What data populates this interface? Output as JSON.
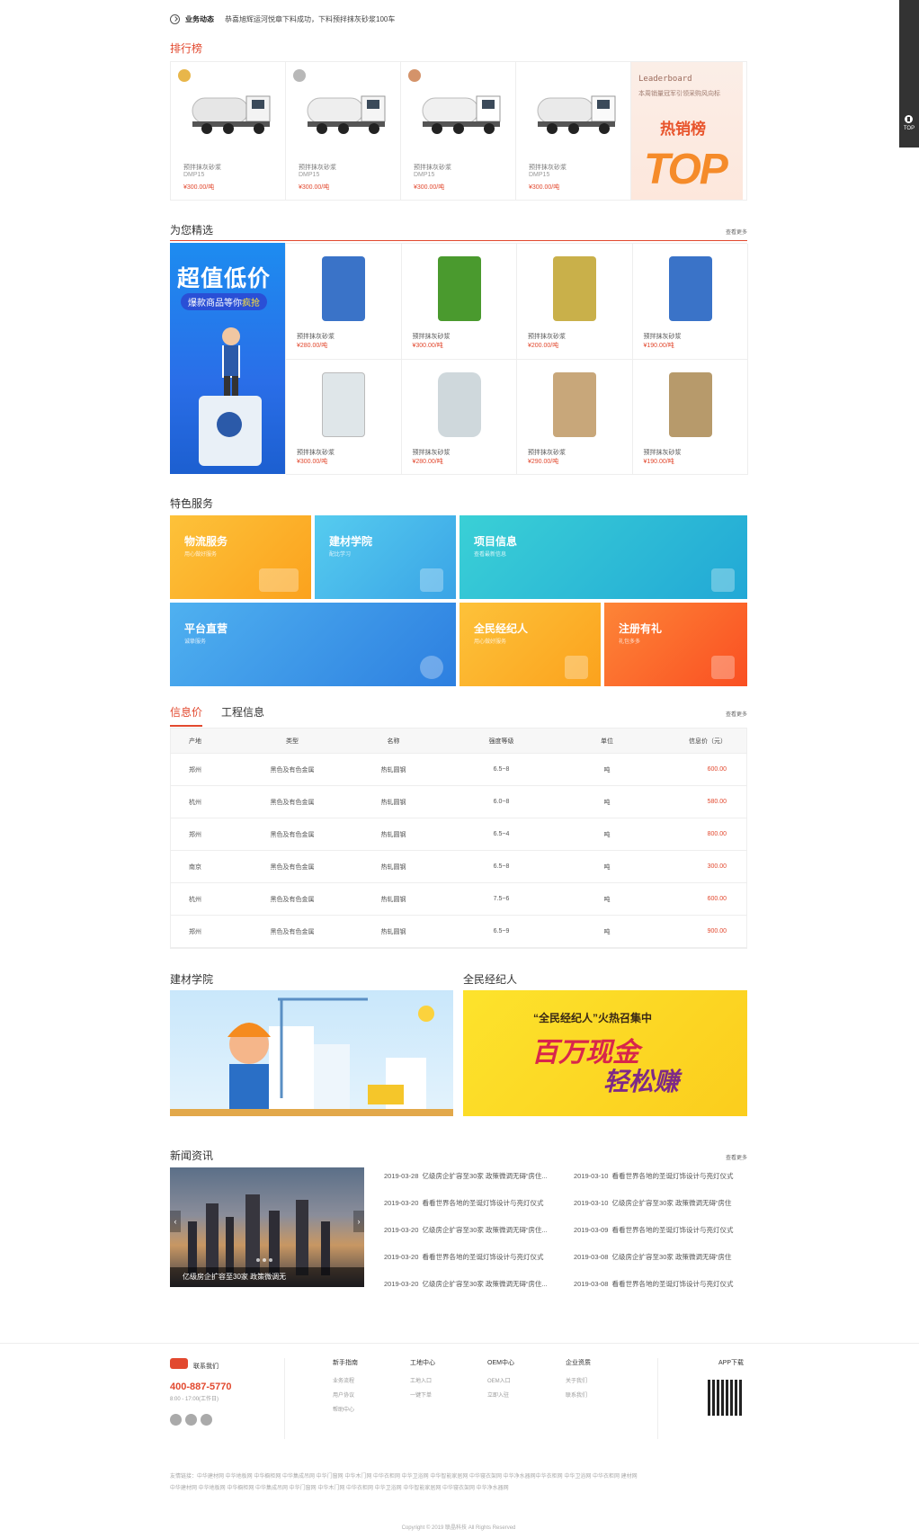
{
  "side": {
    "top_label": "TOP"
  },
  "notice": {
    "label": "业务动态",
    "text": "恭喜旭辉运河悦章下料成功，下料预拌抹灰砂浆100车"
  },
  "ranking": {
    "title": "排行榜",
    "items": [
      {
        "name": "预拌抹灰砂浆",
        "code": "DMP15",
        "price": "¥300.00/吨",
        "medal_color": "#e8b64a"
      },
      {
        "name": "预拌抹灰砂浆",
        "code": "DMP15",
        "price": "¥300.00/吨",
        "medal_color": "#b8b8b8"
      },
      {
        "name": "预拌抹灰砂浆",
        "code": "DMP15",
        "price": "¥300.00/吨",
        "medal_color": "#d4936a"
      },
      {
        "name": "预拌抹灰砂浆",
        "code": "DMP15",
        "price": "¥300.00/吨",
        "medal_color": ""
      }
    ],
    "banner": {
      "line1": "Leaderboard",
      "line2": "本周销量冠军引领采购风向标",
      "hot": "热销榜",
      "top": "TOP"
    }
  },
  "picks": {
    "title": "为您精选",
    "more": "查看更多",
    "banner": {
      "line1": "超值低价",
      "line2_prefix": "爆款商品等你",
      "line2_hl": "疯抢"
    },
    "items": [
      {
        "name": "预拌抹灰砂浆",
        "price": "¥280.00/吨",
        "color": "#3a73c8"
      },
      {
        "name": "预拌抹灰砂浆",
        "price": "¥300.00/吨",
        "color": "#4a9a2e"
      },
      {
        "name": "预拌抹灰砂浆",
        "price": "¥200.00/吨",
        "color": "#c9b04a"
      },
      {
        "name": "预拌抹灰砂浆",
        "price": "¥190.00/吨",
        "color": "#3a73c8"
      },
      {
        "name": "预拌抹灰砂浆",
        "price": "¥300.00/吨",
        "color": "#dfe6e9"
      },
      {
        "name": "预拌抹灰砂浆",
        "price": "¥280.00/吨",
        "color": "#cfd8dc"
      },
      {
        "name": "预拌抹灰砂浆",
        "price": "¥290.00/吨",
        "color": "#c8a77a"
      },
      {
        "name": "预拌抹灰砂浆",
        "price": "¥190.00/吨",
        "color": "#b79a6b"
      }
    ]
  },
  "services": {
    "title": "特色服务",
    "tiles": [
      {
        "title": "物流服务",
        "sub": "用心做好服务",
        "color": "#fbb024"
      },
      {
        "title": "建材学院",
        "sub": "配比学习",
        "color": "#4cbce8"
      },
      {
        "title": "项目信息",
        "sub": "查看最新信息",
        "color": "#2fbdd4"
      },
      {
        "title": "平台直营",
        "sub": "诚挚服务",
        "color": "#3b9fe8"
      },
      {
        "title": "全民经纪人",
        "sub": "用心做好服务",
        "color": "#fbae24"
      },
      {
        "title": "注册有礼",
        "sub": "礼包多多",
        "color": "#fa6a2c"
      }
    ]
  },
  "info": {
    "tab_active": "信息价",
    "tab_other": "工程信息",
    "more": "查看更多",
    "headers": [
      "产地",
      "类型",
      "名称",
      "强度等级",
      "单位",
      "信息价（元）"
    ],
    "rows": [
      [
        "郑州",
        "黑色及有色金属",
        "热轧圆钢",
        "6.5~8",
        "吨",
        "600.00"
      ],
      [
        "杭州",
        "黑色及有色金属",
        "热轧圆钢",
        "6.0~8",
        "吨",
        "580.00"
      ],
      [
        "郑州",
        "黑色及有色金属",
        "热轧圆钢",
        "6.5~4",
        "吨",
        "800.00"
      ],
      [
        "南京",
        "黑色及有色金属",
        "热轧圆钢",
        "6.5~8",
        "吨",
        "300.00"
      ],
      [
        "杭州",
        "黑色及有色金属",
        "热轧圆钢",
        "7.5~6",
        "吨",
        "600.00"
      ],
      [
        "郑州",
        "黑色及有色金属",
        "热轧圆钢",
        "6.5~9",
        "吨",
        "900.00"
      ]
    ]
  },
  "duo": {
    "left_title": "建材学院",
    "right_title": "全民经纪人",
    "right_banner": {
      "line1": "“全民经纪人”火热召集中",
      "line2": "百万现金",
      "line3": "轻松赚"
    }
  },
  "news": {
    "title": "新闻资讯",
    "more": "查看更多",
    "caption": "亿级房企扩容至30家 政策微调无",
    "left": [
      {
        "date": "2019-03-28",
        "text": "亿级房企扩容至30家 政策微调无碍“房住..."
      },
      {
        "date": "2019-03-20",
        "text": "看看世界各地的圣诞灯饰设计与亮灯仪式"
      },
      {
        "date": "2019-03-20",
        "text": "亿级房企扩容至30家 政策微调无碍“房住..."
      },
      {
        "date": "2019-03-20",
        "text": "看看世界各地的圣诞灯饰设计与亮灯仪式"
      },
      {
        "date": "2019-03-20",
        "text": "亿级房企扩容至30家 政策微调无碍“房住..."
      }
    ],
    "right": [
      {
        "date": "2019-03-10",
        "text": "看看世界各地的圣诞灯饰设计与亮灯仪式"
      },
      {
        "date": "2019-03-10",
        "text": "亿级房企扩容至30家 政策微调无碍“房住"
      },
      {
        "date": "2019-03-09",
        "text": "看看世界各地的圣诞灯饰设计与亮灯仪式"
      },
      {
        "date": "2019-03-08",
        "text": "亿级房企扩容至30家 政策微调无碍“房住"
      },
      {
        "date": "2019-03-08",
        "text": "看看世界各地的圣诞灯饰设计与亮灯仪式"
      }
    ]
  },
  "footer": {
    "contact_label": "联系我们",
    "phone": "400-887-5770",
    "hours": "8:00 - 17:00(工作日)",
    "cols": [
      {
        "head": "新手指南",
        "subs": [
          "业务流程",
          "用户协议",
          "帮助中心"
        ]
      },
      {
        "head": "工地中心",
        "subs": [
          "工地入口",
          "一键下单"
        ]
      },
      {
        "head": "OEM中心",
        "subs": [
          "OEM入口",
          "立即入驻"
        ]
      },
      {
        "head": "企业资质",
        "subs": [
          "关于我们",
          "联系我们"
        ]
      }
    ],
    "app": "APP下载",
    "links1": "友情链接：中华建材网  中华地板网  中华橱柜网  中华集成吊网  中华门窗网  中华木门网  中华衣柜网  中华卫浴网  中华智能家居网  中华寝衣架网  中华净水器网中华衣柜网  中华卫浴网  中华衣柜网  建材网",
    "links2": "中华建材网  中华地板网  中华橱柜网  中华集成吊网  中华门窗网  中华木门网  中华衣柜网  中华卫浴网  中华智能家居网  中华寝衣架网  中华净水器网",
    "copyright": "Copyright © 2019 联晶科技 All Rights Reserved"
  }
}
